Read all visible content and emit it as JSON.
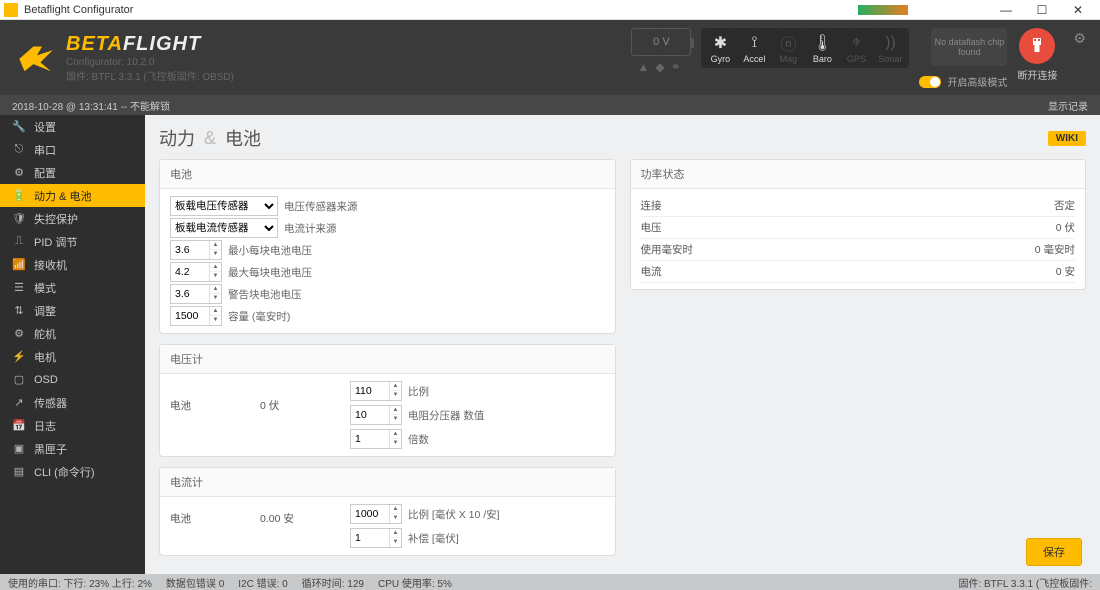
{
  "title": "Betaflight Configurator",
  "brand": {
    "a": "BETA",
    "b": "FLIGHT",
    "conf": "Configurator: 10.2.0",
    "fw": "固件: BTFL 3.3.1 (飞控板固件: OBSD)"
  },
  "battery_header": {
    "volts": "0 V"
  },
  "sensors": [
    {
      "name": "Gyro",
      "icon": "✱",
      "on": true
    },
    {
      "name": "Accel",
      "icon": "⟟",
      "on": true
    },
    {
      "name": "Mag",
      "icon": "ⓝ",
      "on": false
    },
    {
      "name": "Baro",
      "icon": "🌡",
      "on": true
    },
    {
      "name": "GPS",
      "icon": "⌖",
      "on": false
    },
    {
      "name": "Sonar",
      "icon": "))",
      "on": false
    }
  ],
  "dataflash": "No dataflash chip found",
  "expert_label": "开启高级模式",
  "disconnect_label": "断开连接",
  "status_bar": {
    "left": "2018-10-28 @ 13:31:41 -- 不能解锁",
    "right": "显示记录"
  },
  "sidebar": [
    {
      "icon": "🔧",
      "label": "设置"
    },
    {
      "icon": "⎋",
      "label": "串口"
    },
    {
      "icon": "⚙",
      "label": "配置"
    },
    {
      "icon": "🔋",
      "label": "动力 & 电池"
    },
    {
      "icon": "🛡",
      "label": "失控保护"
    },
    {
      "icon": "⎍",
      "label": "PID 调节"
    },
    {
      "icon": "📶",
      "label": "接收机"
    },
    {
      "icon": "☰",
      "label": "模式"
    },
    {
      "icon": "⇅",
      "label": "调整"
    },
    {
      "icon": "⚙",
      "label": "舵机"
    },
    {
      "icon": "⚡",
      "label": "电机"
    },
    {
      "icon": "▢",
      "label": "OSD"
    },
    {
      "icon": "↗",
      "label": "传感器"
    },
    {
      "icon": "📅",
      "label": "日志"
    },
    {
      "icon": "▣",
      "label": "黑匣子"
    },
    {
      "icon": "▤",
      "label": "CLI (命令行)"
    }
  ],
  "page": {
    "title_a": "动力",
    "title_b": "电池",
    "wiki": "WIKI"
  },
  "battery_panel": {
    "title": "电池",
    "voltage_src_sel": "板载电压传感器",
    "voltage_src_lbl": "电压传感器来源",
    "current_src_sel": "板载电流传感器",
    "current_src_lbl": "电流计来源",
    "min_cell": "3.6",
    "min_cell_lbl": "最小每块电池电压",
    "max_cell": "4.2",
    "max_cell_lbl": "最大每块电池电压",
    "warn_cell": "3.6",
    "warn_cell_lbl": "警告块电池电压",
    "capacity": "1500",
    "capacity_lbl": "容量 (毫安时)"
  },
  "power_state": {
    "title": "功率状态",
    "rows": [
      {
        "k": "连接",
        "v": "否定"
      },
      {
        "k": "电压",
        "v": "0 伏"
      },
      {
        "k": "使用毫安时",
        "v": "0 毫安时"
      },
      {
        "k": "电流",
        "v": "0 安"
      }
    ]
  },
  "vmeter": {
    "title": "电压计",
    "name": "电池",
    "value": "0 伏",
    "scale": "110",
    "scale_lbl": "比例",
    "div": "10",
    "div_lbl": "电阻分压器 数值",
    "mult": "1",
    "mult_lbl": "倍数"
  },
  "ameter": {
    "title": "电流计",
    "name": "电池",
    "value": "0.00 安",
    "scale": "1000",
    "scale_lbl": "比例 [毫伏 X 10 /安]",
    "offset": "1",
    "offset_lbl": "补偿 [毫伏]"
  },
  "save": "保存",
  "footer": {
    "port": "使用的串口: 下行: 23% 上行: 2%",
    "err": "数据包错误 0",
    "i2c": "I2C 错误: 0",
    "loop": "循环时间: 129",
    "cpu": "CPU 使用率: 5%",
    "fw": "固件: BTFL 3.3.1 (飞控板固件:"
  }
}
